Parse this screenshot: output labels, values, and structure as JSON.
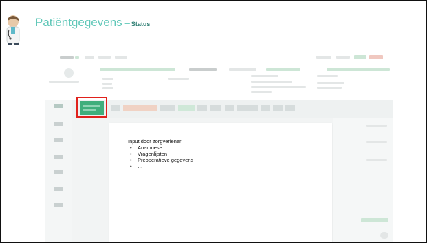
{
  "slide": {
    "title": "Patiëntgegevens",
    "title_separator": "–",
    "subtitle": "Status"
  },
  "callout": {
    "heading": "Input door zorgverlener",
    "items": [
      "Anamnese",
      "Vragenlijsten",
      "Preoperatieve gegevens",
      "…"
    ]
  },
  "icons": {
    "header": "doctor-avatar-icon"
  },
  "colors": {
    "title": "#5fc7b8",
    "highlight_border": "#e0211c",
    "active_tab": "#3fae7c"
  }
}
